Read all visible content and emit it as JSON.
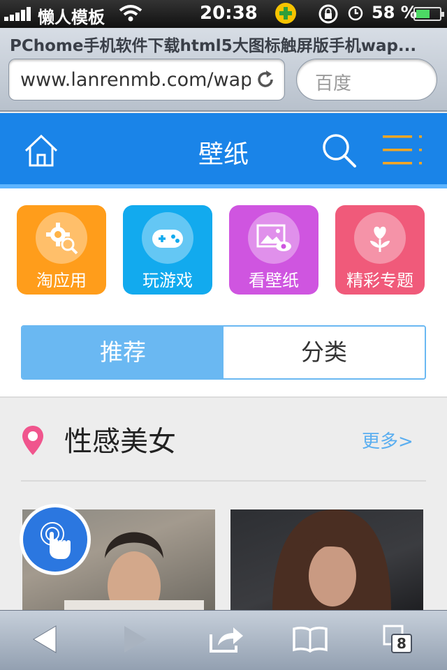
{
  "statusbar": {
    "carrier": "懒人模板",
    "time": "20:38",
    "battery": "58 %",
    "battery_level": 0.58
  },
  "browser": {
    "page_title": "PChome手机软件下载html5大图标触屏版手机wap...",
    "url": "www.lanrenmb.com/wap",
    "search_placeholder": "百度",
    "tab_count": "8"
  },
  "header": {
    "title": "壁纸"
  },
  "quick_entries": [
    {
      "label": "淘应用",
      "color": "#ff9d1b",
      "icon": "gear-search-icon"
    },
    {
      "label": "玩游戏",
      "color": "#12aaee",
      "icon": "gamepad-icon"
    },
    {
      "label": "看壁纸",
      "color": "#cf55e0",
      "icon": "picture-eye-icon"
    },
    {
      "label": "精彩专题",
      "color": "#f05a7a",
      "icon": "flower-icon"
    }
  ],
  "tabs": {
    "recommend": "推荐",
    "category": "分类"
  },
  "section": {
    "title": "性感美女",
    "more": "更多>"
  }
}
